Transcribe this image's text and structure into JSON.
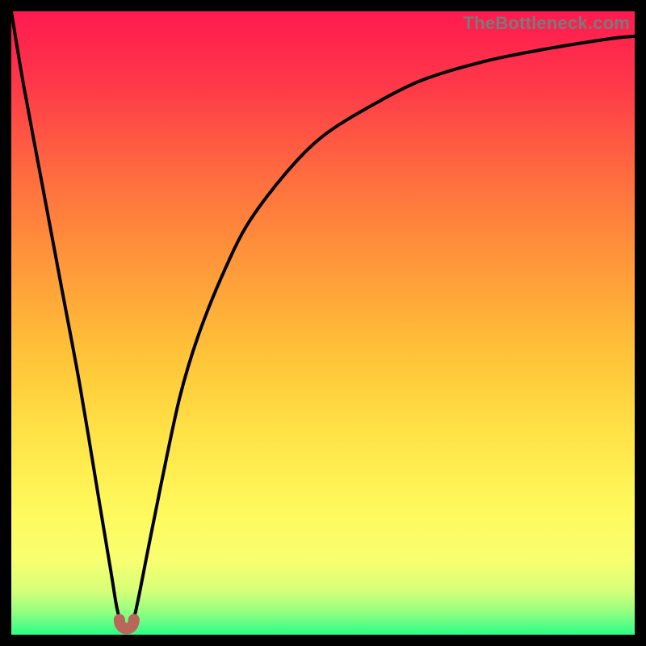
{
  "watermark": "TheBottleneck.com",
  "chart_data": {
    "type": "line",
    "title": "",
    "xlabel": "",
    "ylabel": "",
    "xlim": [
      0,
      100
    ],
    "ylim": [
      0,
      100
    ],
    "series": [
      {
        "name": "bottleneck-curve",
        "x": [
          0,
          2,
          5,
          8,
          11,
          14,
          16,
          17,
          18,
          19,
          20,
          22,
          24,
          27,
          30,
          34,
          38,
          44,
          50,
          58,
          66,
          76,
          86,
          96,
          100
        ],
        "y": [
          100,
          88,
          72,
          56,
          40,
          22,
          10,
          4,
          1,
          1,
          4,
          14,
          24,
          38,
          48,
          58,
          66,
          74,
          80,
          85,
          89,
          92,
          94,
          95.6,
          96
        ]
      }
    ],
    "marker": {
      "name": "optimal-point",
      "x": 18.5,
      "y": 1,
      "color": "#bb665b"
    },
    "gradient_stops": [
      {
        "pos": 0.0,
        "color": "#ff1a4f"
      },
      {
        "pos": 0.12,
        "color": "#ff3949"
      },
      {
        "pos": 0.26,
        "color": "#ff6b3f"
      },
      {
        "pos": 0.4,
        "color": "#ff963a"
      },
      {
        "pos": 0.55,
        "color": "#ffc338"
      },
      {
        "pos": 0.68,
        "color": "#ffe347"
      },
      {
        "pos": 0.8,
        "color": "#fff95c"
      },
      {
        "pos": 0.88,
        "color": "#f8ff70"
      },
      {
        "pos": 0.93,
        "color": "#d6ff78"
      },
      {
        "pos": 0.965,
        "color": "#8fff80"
      },
      {
        "pos": 1.0,
        "color": "#2bff87"
      }
    ]
  }
}
